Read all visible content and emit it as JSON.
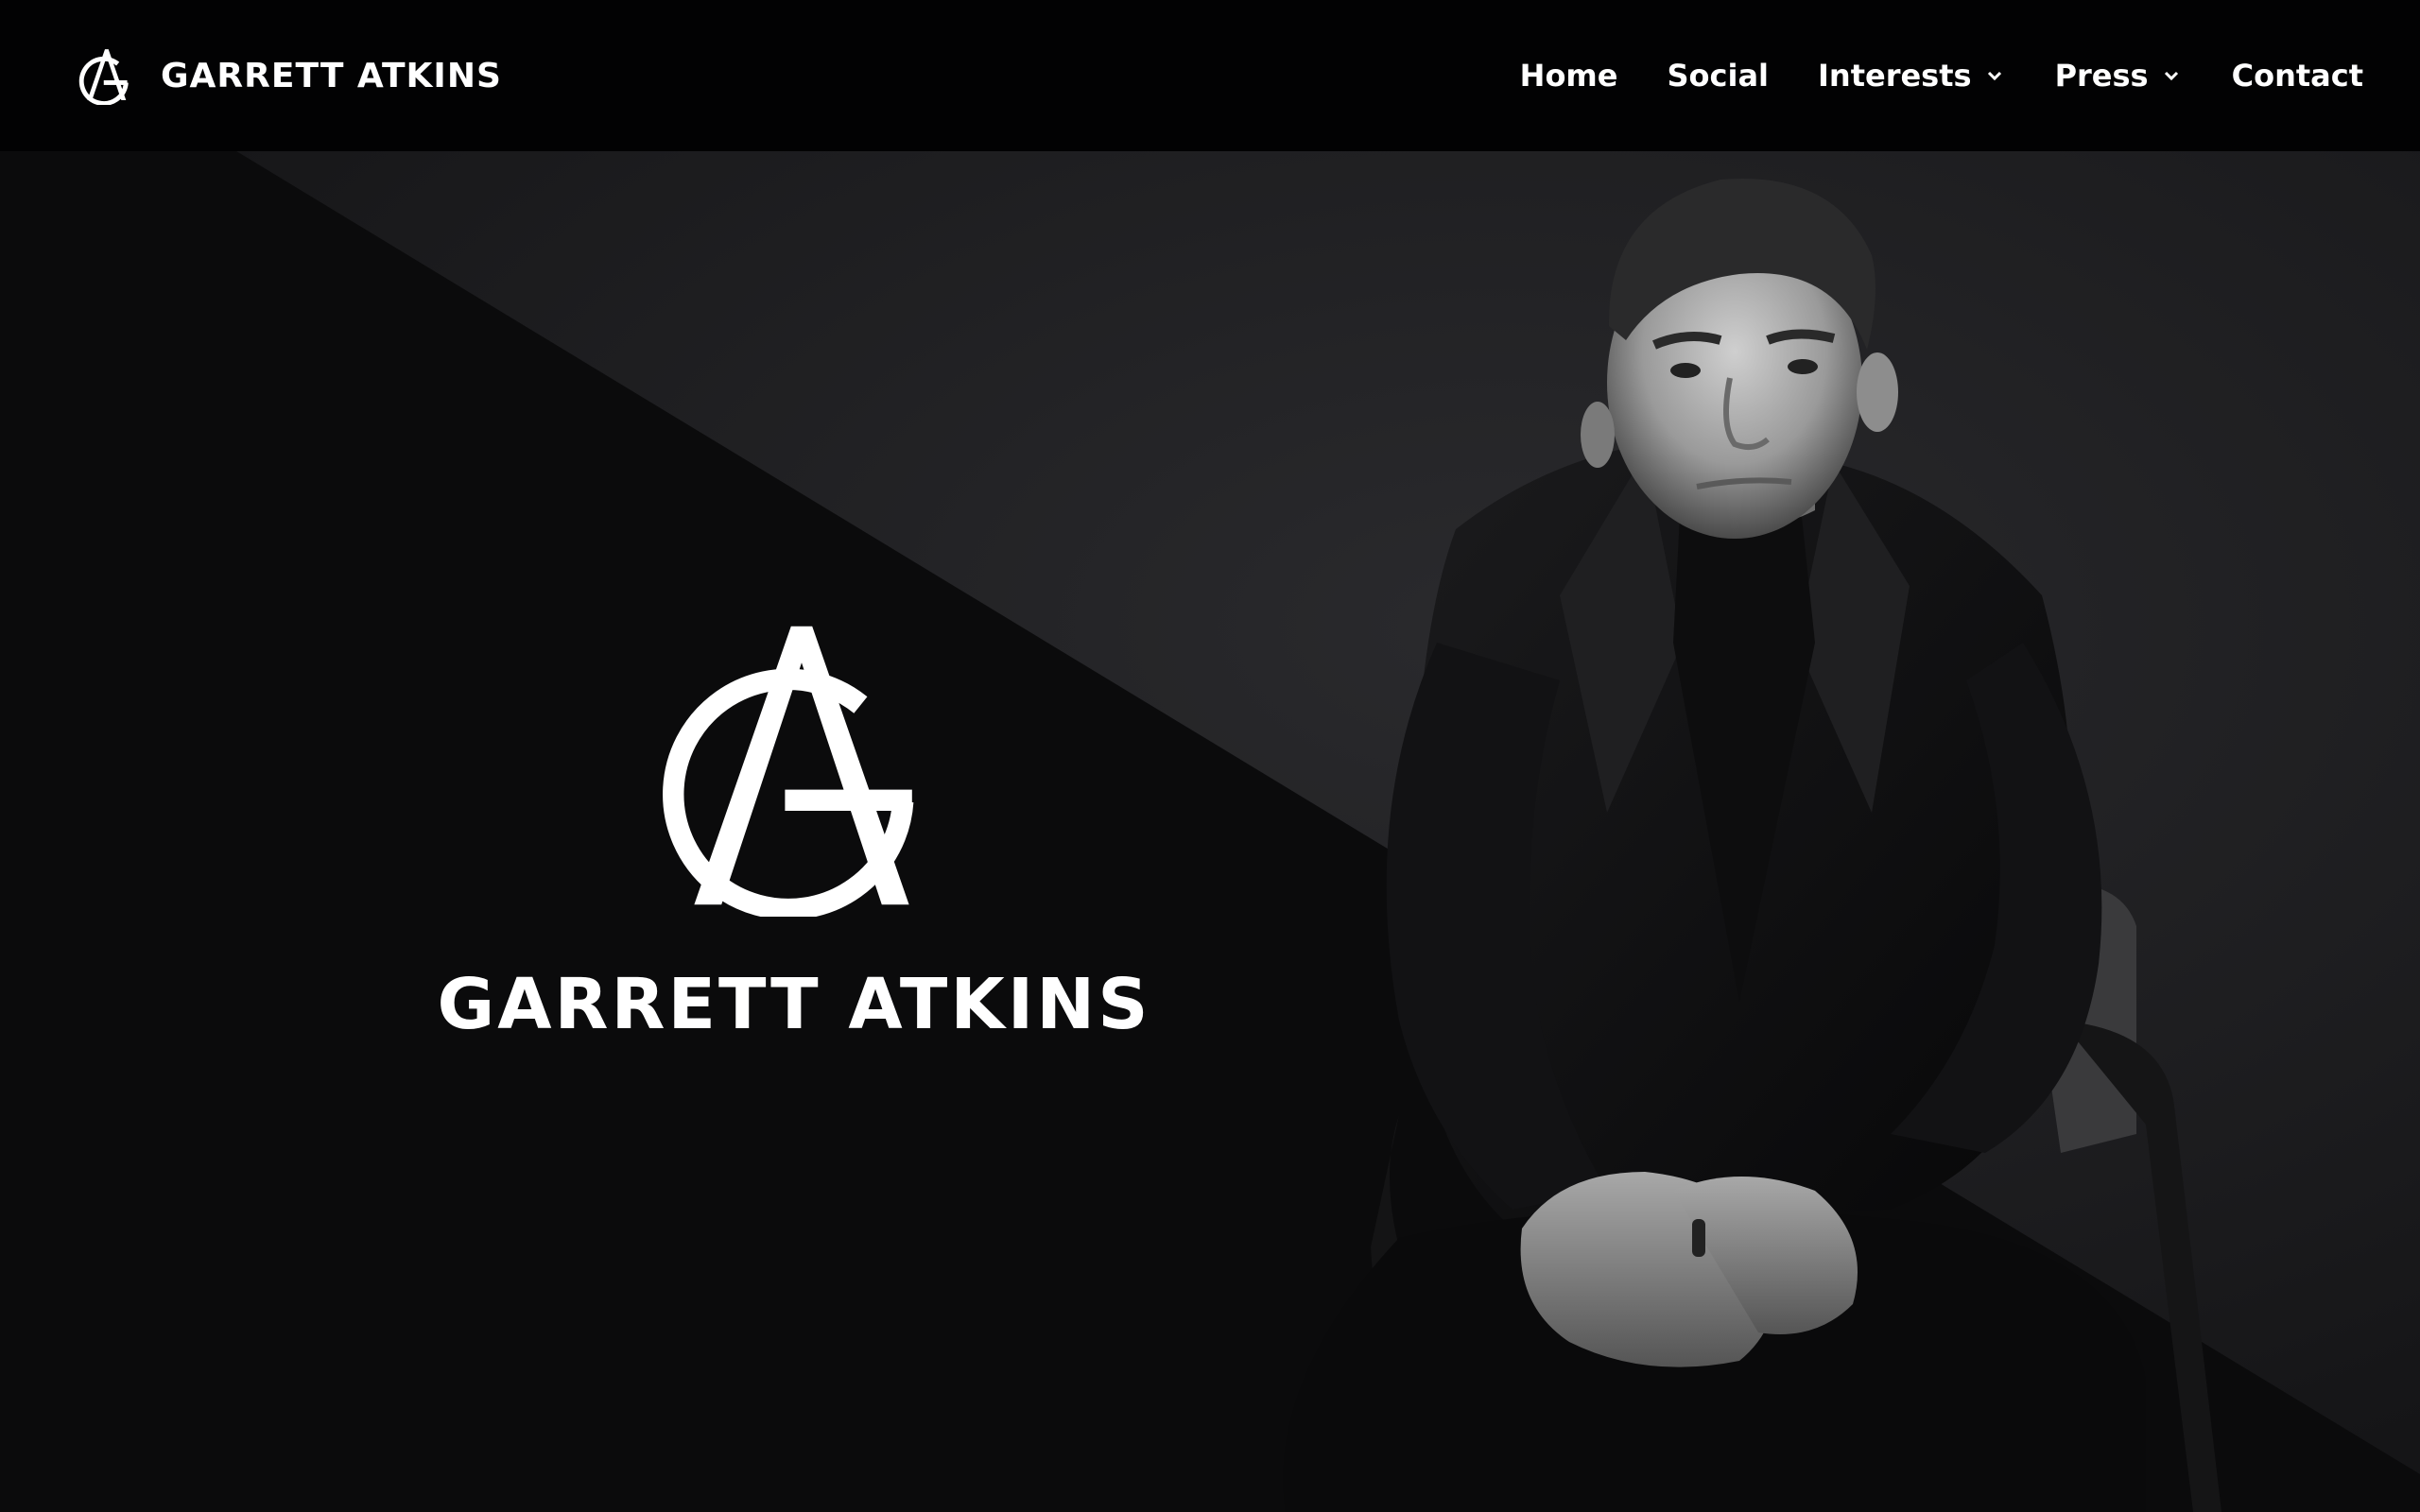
{
  "brand": {
    "name": "GARRETT ATKINS",
    "logo_icon": "ag-monogram-icon"
  },
  "nav": {
    "items": [
      {
        "label": "Home",
        "has_dropdown": false
      },
      {
        "label": "Social",
        "has_dropdown": false
      },
      {
        "label": "Interests",
        "has_dropdown": true
      },
      {
        "label": "Press",
        "has_dropdown": true
      },
      {
        "label": "Contact",
        "has_dropdown": false
      }
    ]
  },
  "hero": {
    "title": "GARRETT ATKINS",
    "logo_icon": "ag-monogram-icon",
    "portrait": "man-in-dark-suit-seated-portrait"
  },
  "colors": {
    "nav_background": "#020203",
    "hero_dark_panel": "#0b0b0c",
    "hero_background": "#1c1c1f",
    "text": "#ffffff"
  }
}
